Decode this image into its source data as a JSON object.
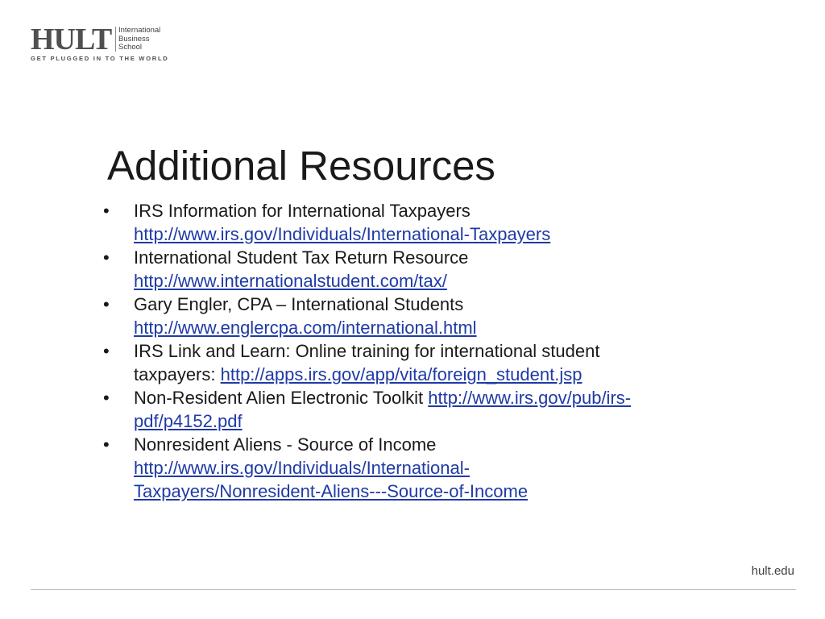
{
  "logo": {
    "name": "HULT",
    "school_lines": [
      "International",
      "Business",
      "School"
    ],
    "tagline": "GET PLUGGED IN TO THE WORLD"
  },
  "slide": {
    "title": "Additional Resources"
  },
  "resources": [
    {
      "line1_text": "IRS Information for International Taxpayers",
      "line1_link": "",
      "line2_text": "",
      "line2_link": "http://www.irs.gov/Individuals/International-Taxpayers"
    },
    {
      "line1_text": "International Student Tax Return Resource",
      "line1_link": "",
      "line2_text": "",
      "line2_link": "http://www.internationalstudent.com/tax/"
    },
    {
      "line1_text": "Gary Engler, CPA – International Students",
      "line1_link": "",
      "line2_text": "",
      "line2_link": "http://www.englercpa.com/international.html"
    },
    {
      "line1_text": "IRS Link and Learn: Online training for international student",
      "line1_link": "",
      "line2_text": "taxpayers: ",
      "line2_link": "http://apps.irs.gov/app/vita/foreign_student.jsp"
    },
    {
      "line1_text": "Non-Resident Alien Electronic Toolkit ",
      "line1_link": "http://www.irs.gov/pub/irs-",
      "line2_text": "",
      "line2_link": "pdf/p4152.pdf"
    },
    {
      "line1_text": "Nonresident Aliens - Source of Income",
      "line1_link": "",
      "line2_text": "",
      "line2_link": "http://www.irs.gov/Individuals/International-",
      "line3_text": "",
      "line3_link": "Taxpayers/Nonresident-Aliens---Source-of-Income"
    }
  ],
  "footer": {
    "site": "hult.edu"
  },
  "colors": {
    "link": "#1f3aa6",
    "text": "#1a1a1a",
    "logo": "#505050"
  }
}
